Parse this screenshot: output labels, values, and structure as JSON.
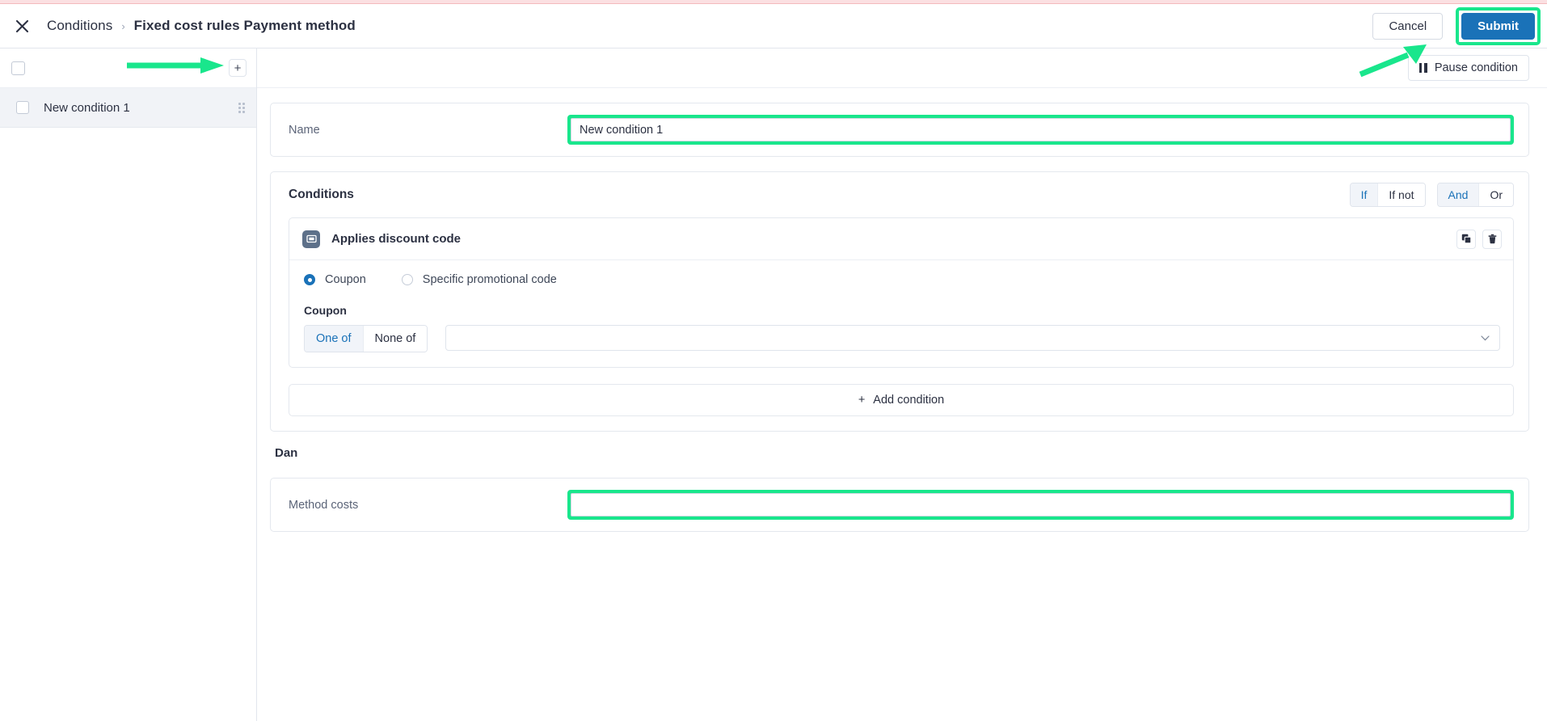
{
  "header": {
    "close_icon": "close-icon",
    "breadcrumb_root": "Conditions",
    "breadcrumb_sep": "›",
    "breadcrumb_current": "Fixed cost rules Payment method",
    "cancel_label": "Cancel",
    "submit_label": "Submit"
  },
  "sidebar": {
    "add_label": "+",
    "items": [
      {
        "label": "New condition 1"
      }
    ]
  },
  "main": {
    "pause_label": "Pause condition",
    "name_field": {
      "label": "Name",
      "value": "New condition 1"
    },
    "conditions": {
      "title": "Conditions",
      "if_group": [
        {
          "label": "If",
          "active": true
        },
        {
          "label": "If not",
          "active": false
        }
      ],
      "and_group": [
        {
          "label": "And",
          "active": true
        },
        {
          "label": "Or",
          "active": false
        }
      ],
      "items": [
        {
          "icon": "coupon-ticket-icon",
          "title": "Applies discount code",
          "duplicate_icon": "duplicate-icon",
          "delete_icon": "trash-icon",
          "radios": [
            {
              "label": "Coupon",
              "selected": true
            },
            {
              "label": "Specific promotional code",
              "selected": false
            }
          ],
          "sub_label": "Coupon",
          "match_group": [
            {
              "label": "One of",
              "active": true
            },
            {
              "label": "None of",
              "active": false
            }
          ],
          "select_value": "",
          "select_chevron": "chevron-down-icon"
        }
      ],
      "add_condition_label": "Add condition",
      "add_condition_plus": "+"
    },
    "dan_section": {
      "title": "Dan",
      "method_costs": {
        "label": "Method costs",
        "value": ""
      }
    }
  },
  "colors": {
    "highlight": "#19e68c",
    "accent": "#1a72b8",
    "top_strip": "#fbe0e2"
  }
}
